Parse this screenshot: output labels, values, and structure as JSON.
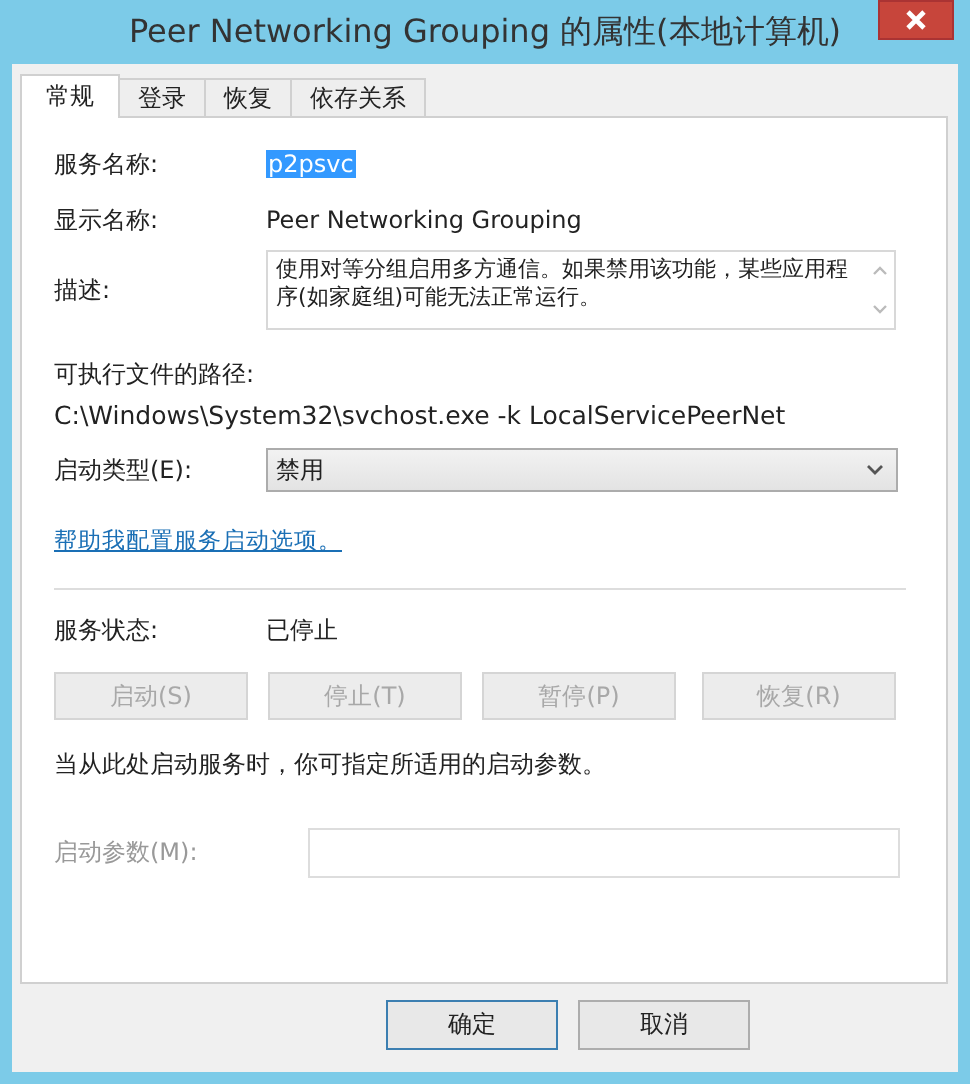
{
  "window": {
    "title": "Peer Networking Grouping 的属性(本地计算机)"
  },
  "tabs": [
    {
      "label": "常规",
      "selected": true
    },
    {
      "label": "登录",
      "selected": false
    },
    {
      "label": "恢复",
      "selected": false
    },
    {
      "label": "依存关系",
      "selected": false
    }
  ],
  "service_name": {
    "label": "服务名称:",
    "value": "p2psvc",
    "selected": true
  },
  "display_name": {
    "label": "显示名称:",
    "value": "Peer Networking Grouping"
  },
  "description": {
    "label": "描述:",
    "value": "使用对等分组启用多方通信。如果禁用该功能，某些应用程序(如家庭组)可能无法正常运行。"
  },
  "executable_path": {
    "label": "可执行文件的路径:",
    "value": "C:\\Windows\\System32\\svchost.exe -k LocalServicePeerNet"
  },
  "startup_type": {
    "label": "启动类型(E):",
    "value": "禁用"
  },
  "help_link": "帮助我配置服务启动选项。",
  "service_status": {
    "label": "服务状态:",
    "value": "已停止"
  },
  "service_buttons": [
    {
      "label": "启动(S)",
      "disabled": true
    },
    {
      "label": "停止(T)",
      "disabled": true
    },
    {
      "label": "暂停(P)",
      "disabled": true
    },
    {
      "label": "恢复(R)",
      "disabled": true
    }
  ],
  "start_hint": "当从此处启动服务时，你可指定所适用的启动参数。",
  "start_params": {
    "label": "启动参数(M):",
    "disabled": true
  },
  "dialog_buttons": [
    {
      "label": "确定",
      "default": true
    },
    {
      "label": "取消",
      "default": false
    }
  ]
}
